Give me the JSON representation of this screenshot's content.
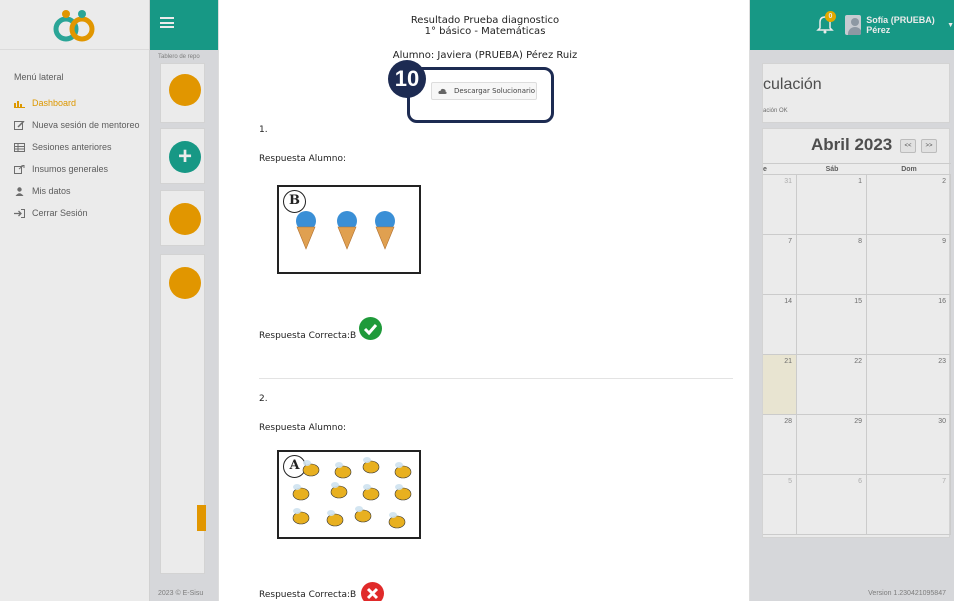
{
  "sidebar": {
    "menu_title": "Menú lateral",
    "items": [
      {
        "label": "Dashboard",
        "icon": "chart-icon",
        "active": true
      },
      {
        "label": "Nueva sesión de mentoreo",
        "icon": "edit-icon"
      },
      {
        "label": "Sesiones anteriores",
        "icon": "table-icon"
      },
      {
        "label": "Insumos generales",
        "icon": "external-link-icon"
      },
      {
        "label": "Mis datos",
        "icon": "user-icon"
      },
      {
        "label": "Cerrar Sesión",
        "icon": "logout-icon"
      }
    ]
  },
  "topbar": {
    "notification_count": "0",
    "user_name": "Sofía (PRUEBA) Pérez"
  },
  "breadcrumb": "Tablero de repo",
  "match_card": {
    "title": "culación",
    "subtitle": "ación OK"
  },
  "calendar": {
    "title": "Abril 2023",
    "prev": "<<",
    "next": ">>",
    "headers": [
      "e",
      "Sáb",
      "Dom"
    ],
    "rows": [
      [
        "31",
        "1",
        "2"
      ],
      [
        "7",
        "8",
        "9"
      ],
      [
        "14",
        "15",
        "16"
      ],
      [
        "21",
        "22",
        "23"
      ],
      [
        "28",
        "29",
        "30"
      ],
      [
        "5",
        "6",
        "7"
      ]
    ]
  },
  "footer": {
    "left": "2023 © E-Sisu",
    "right": "Version 1.230421095847"
  },
  "modal": {
    "title_line1": "Resultado Prueba diagnostico",
    "title_line2": "1° básico - Matemáticas",
    "student": "Alumno: Javiera (PRUEBA) Pérez Ruiz",
    "download_label": "Descargar Solucionario",
    "step_number": "10",
    "questions": [
      {
        "number": "1.",
        "student_answer_label": "Respuesta Alumno:",
        "chosen_option": "B",
        "correct_label": "Respuesta Correcta:B",
        "is_correct": true
      },
      {
        "number": "2.",
        "student_answer_label": "Respuesta Alumno:",
        "chosen_option": "A",
        "correct_label": "Respuesta Correcta:B",
        "is_correct": false
      }
    ]
  },
  "colors": {
    "teal": "#19a591",
    "orange": "#f5a300",
    "navy": "#1d2b52",
    "green": "#1f9a3a",
    "red": "#e02a2a"
  }
}
